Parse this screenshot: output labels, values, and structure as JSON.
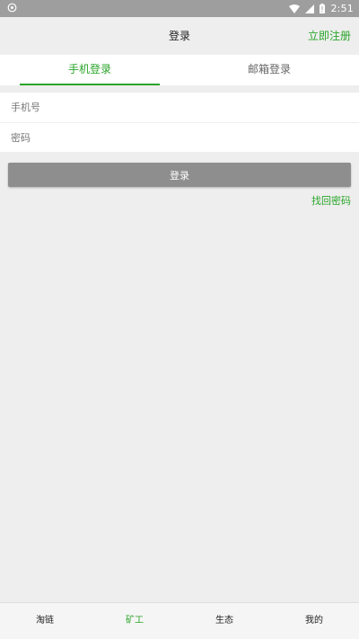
{
  "status_bar": {
    "time": "2:51",
    "left_icon": "app-notification-icon",
    "icons": [
      "wifi-icon",
      "signal-icon",
      "battery-icon"
    ]
  },
  "header": {
    "title": "登录",
    "register_label": "立即注册"
  },
  "tabs": [
    {
      "label": "手机登录",
      "active": true
    },
    {
      "label": "邮箱登录",
      "active": false
    }
  ],
  "form": {
    "phone_placeholder": "手机号",
    "phone_value": "",
    "password_placeholder": "密码",
    "password_value": ""
  },
  "login_button_label": "登录",
  "forgot_password_label": "找回密码",
  "bottom_nav": [
    {
      "label": "淘链",
      "active": false
    },
    {
      "label": "矿工",
      "active": true
    },
    {
      "label": "生态",
      "active": false
    },
    {
      "label": "我的",
      "active": false
    }
  ],
  "colors": {
    "accent": "#2aa52a",
    "background": "#eeeeee",
    "button_disabled": "#8e8e8e",
    "status_bar": "#9e9e9e"
  }
}
